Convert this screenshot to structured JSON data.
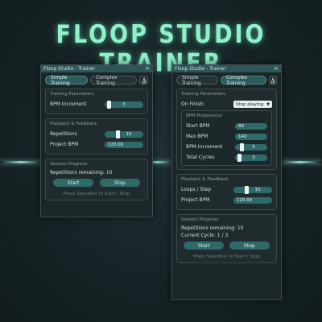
{
  "title": "FLOOP STUDIO TRAINER",
  "colors": {
    "accent": "#2f6a6a",
    "title_glow": "#8ef2c9",
    "titlebar": "#2f5558"
  },
  "left": {
    "window_title": "Floop Studio - Trainer",
    "close": "×",
    "tabs": [
      "Simple Training",
      "Complex Training"
    ],
    "active_tab": "Simple Training",
    "training": {
      "title": "Training Parameters",
      "bpm_label": "BPM Increment",
      "bpm_value": "3"
    },
    "playback": {
      "title": "Playback & Feedback",
      "reps_label": "Repetitions",
      "reps_value": "10",
      "bpm_label": "Project BPM",
      "bpm_value": "120.00"
    },
    "session": {
      "title": "Session Progress",
      "remaining": "Repetitions remaining: 10",
      "start": "Start",
      "stop": "Stop",
      "hint": "Press Spacebar to Start / Stop"
    }
  },
  "right": {
    "window_title": "Floop Studio - Trainer",
    "close": "×",
    "tabs": [
      "Simple Training",
      "Complex Training"
    ],
    "active_tab": "Complex Training",
    "training": {
      "title": "Training Parameters",
      "finish_label": "On Finish:",
      "finish_value": "Stop playing"
    },
    "progression": {
      "title": "BPM Progression",
      "start_label": "Start BPM",
      "start_value": "80",
      "max_label": "Max BPM",
      "max_value": "140",
      "inc_label": "BPM Increment",
      "inc_value": "5",
      "cycles_label": "Total Cycles",
      "cycles_value": "3"
    },
    "playback": {
      "title": "Playback & Feedback",
      "loops_label": "Loops / Step",
      "loops_value": "10",
      "bpm_label": "Project BPM",
      "bpm_value": "120.00"
    },
    "session": {
      "title": "Session Progress",
      "remaining": "Repetitions remaining: 10",
      "cycle": "Current Cycle: 1 / 3",
      "start": "Start",
      "stop": "Stop",
      "hint": "Press Spacebar to Start / Stop"
    }
  }
}
